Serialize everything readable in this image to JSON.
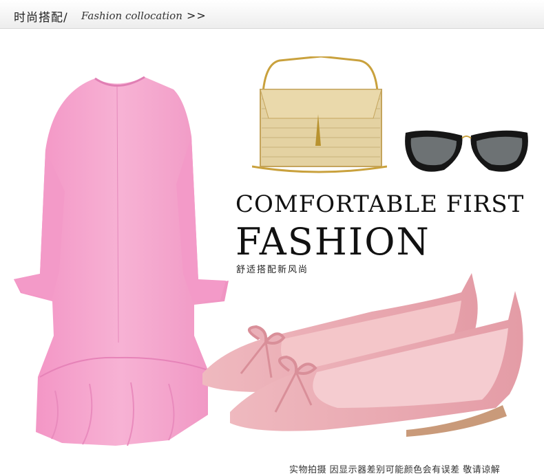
{
  "header": {
    "title_cn": "时尚搭配/",
    "title_en": "Fashion collocation",
    "arrows": ">>"
  },
  "headline": {
    "line1": "COMFORTABLE FIRST",
    "line2": "FASHION",
    "subline": "舒适搭配新风尚"
  },
  "disclaimer": "实物拍摄 因显示器差别可能颜色会有误差 敬请谅解",
  "items": [
    "pink-flared-dress",
    "gold-chain-clutch",
    "black-cat-eye-sunglasses",
    "pink-bow-flats"
  ],
  "colors": {
    "dress": "#f4a6cd",
    "shoes": "#e9a9b0",
    "bag": "#e0c98a",
    "sunglasses": "#1a1a1a"
  }
}
